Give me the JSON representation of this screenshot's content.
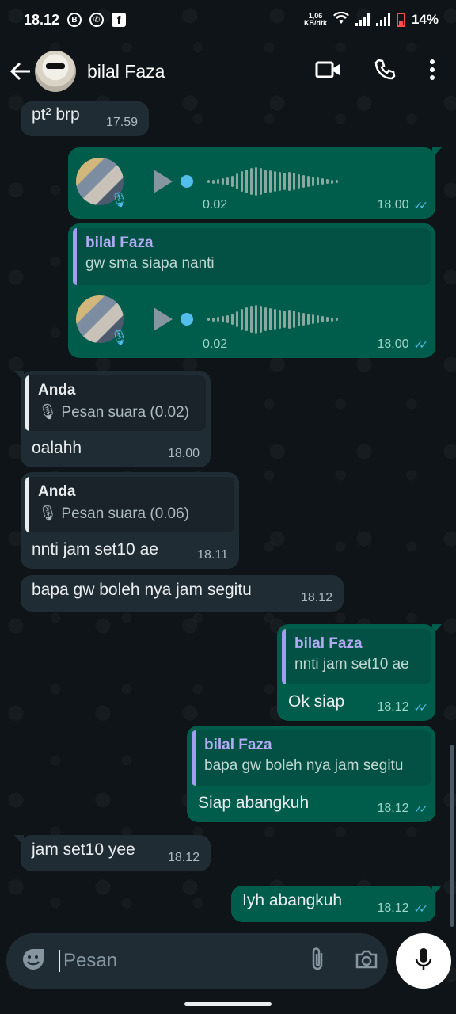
{
  "status_bar": {
    "time": "18.12",
    "net_speed_value": "1,06",
    "net_speed_unit": "KB/dtk",
    "battery": "14%"
  },
  "header": {
    "contact_name": "bilal Faza"
  },
  "messages": [
    {
      "id": "m1",
      "dir": "in",
      "text": "pt² brp",
      "time": "17.59"
    },
    {
      "id": "m2",
      "dir": "out",
      "type": "voice",
      "duration": "0.02",
      "time": "18.00"
    },
    {
      "id": "m3",
      "dir": "out",
      "type": "voice",
      "quote_author": "bilal Faza",
      "quote_text": "gw sma siapa nanti",
      "duration": "0.02",
      "time": "18.00"
    },
    {
      "id": "m4",
      "dir": "in",
      "quote_author": "Anda",
      "quote_text": "Pesan suara (0.02)",
      "text": "oalahh",
      "time": "18.00"
    },
    {
      "id": "m5",
      "dir": "in",
      "quote_author": "Anda",
      "quote_text": "Pesan suara (0.06)",
      "text": "nnti jam set10 ae",
      "time": "18.11"
    },
    {
      "id": "m6",
      "dir": "in",
      "text": "bapa gw boleh nya jam segitu",
      "time": "18.12"
    },
    {
      "id": "m7",
      "dir": "out",
      "quote_author": "bilal Faza",
      "quote_text": "nnti jam set10 ae",
      "text": "Ok siap",
      "time": "18.12"
    },
    {
      "id": "m8",
      "dir": "out",
      "quote_author": "bilal Faza",
      "quote_text": "bapa gw boleh nya jam segitu",
      "text": "Siap abangkuh",
      "time": "18.12"
    },
    {
      "id": "m9",
      "dir": "in",
      "text": "jam set10 yee",
      "time": "18.12"
    },
    {
      "id": "m10",
      "dir": "out",
      "text": "Iyh abangkuh",
      "time": "18.12"
    }
  ],
  "composer": {
    "placeholder": "Pesan"
  },
  "colors": {
    "incoming_bubble": "#202c33",
    "outgoing_bubble": "#005c4b",
    "read_ticks": "#53bdeb",
    "quote_bar": "#a39cf0"
  },
  "icons": {
    "back": "arrow-left-icon",
    "video": "video-call-icon",
    "call": "phone-icon",
    "menu": "more-vertical-icon",
    "emoji": "emoji-icon",
    "attach": "paperclip-icon",
    "camera": "camera-icon",
    "mic": "microphone-icon"
  }
}
